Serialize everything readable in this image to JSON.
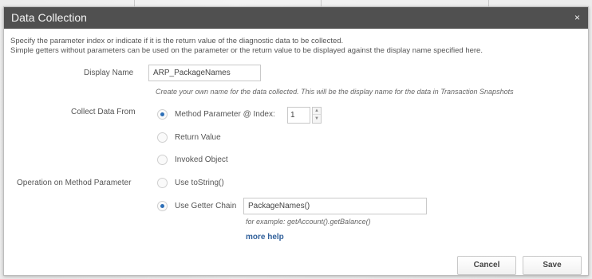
{
  "dialog": {
    "title": "Data Collection",
    "close_glyph": "×",
    "description": [
      "Specify the parameter index or indicate if it is the return value of the diagnostic data to be collected.",
      "Simple getters without parameters can be used on the parameter or the return value to be displayed against the display name specified here."
    ]
  },
  "display_name": {
    "label": "Display Name",
    "value": "ARP_PackageNames",
    "hint": "Create your own name for the data collected.  This will be the display name for the data in Transaction Snapshots"
  },
  "collect_from": {
    "label": "Collect Data From",
    "options": [
      {
        "label": "Method Parameter @ Index:",
        "selected": true
      },
      {
        "label": "Return Value",
        "selected": false
      },
      {
        "label": "Invoked Object",
        "selected": false
      }
    ],
    "index_value": "1",
    "spin_up": "▲",
    "spin_down": "▼"
  },
  "operation": {
    "label": "Operation on Method Parameter",
    "options": [
      {
        "label": "Use toString()",
        "selected": false
      },
      {
        "label": "Use Getter Chain",
        "selected": true
      }
    ],
    "getter_value": "PackageNames()",
    "example": "for example: getAccount().getBalance()",
    "more_help": "more help"
  },
  "buttons": {
    "cancel": "Cancel",
    "save": "Save"
  },
  "colors": {
    "titlebar": "#505050",
    "radio_selected": "#2d6fb7",
    "link": "#2f5f9a"
  }
}
